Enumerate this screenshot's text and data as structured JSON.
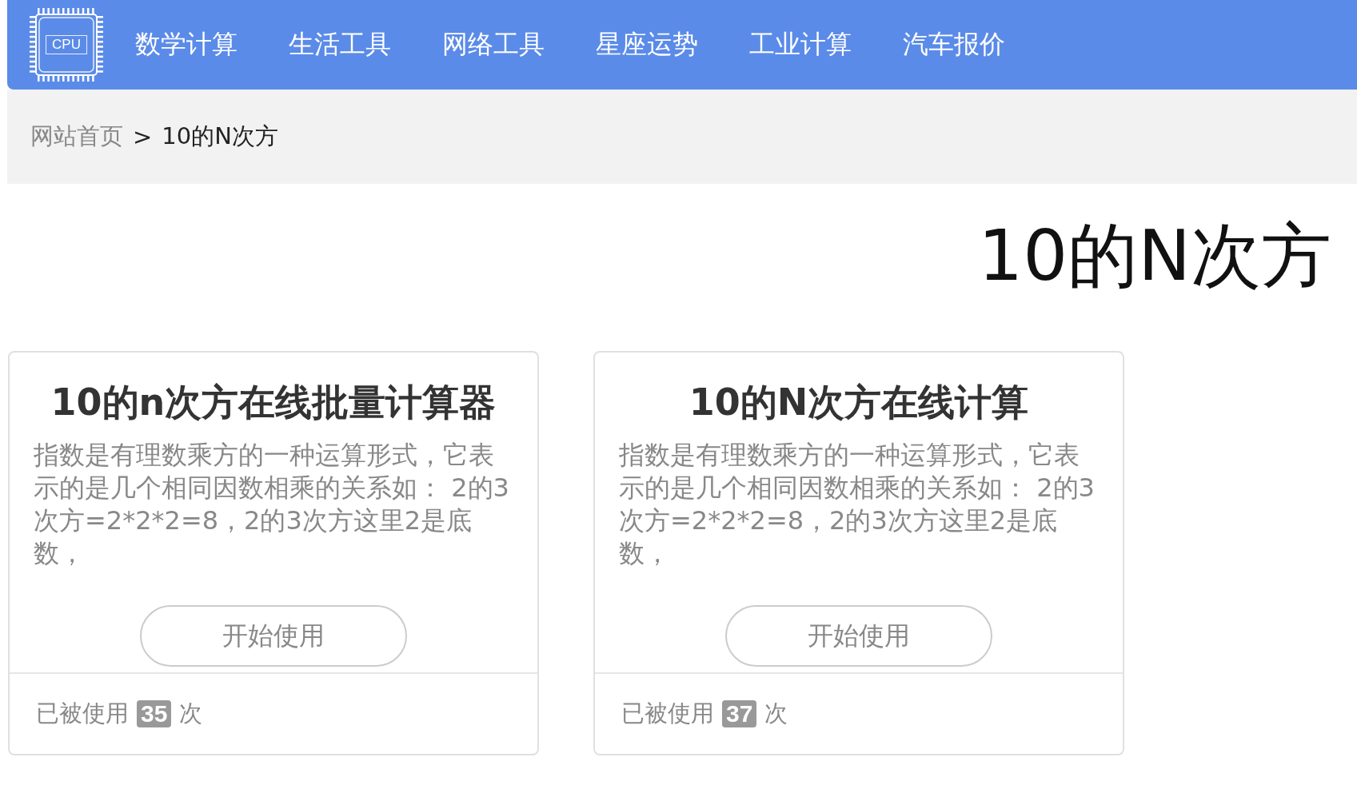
{
  "header": {
    "logo_text": "CPU",
    "nav": [
      "数学计算",
      "生活工具",
      "网络工具",
      "星座运势",
      "工业计算",
      "汽车报价"
    ]
  },
  "breadcrumb": {
    "home": "网站首页",
    "separator": ">",
    "current": "10的N次方"
  },
  "page_title": "10的N次方",
  "cards": [
    {
      "title": "10的n次方在线批量计算器",
      "description": "指数是有理数乘方的一种运算形式，它表示的是几个相同因数相乘的关系如： 2的3次方=2*2*2=8，2的3次方这里2是底数，",
      "button": "开始使用",
      "usage_prefix": "已被使用",
      "usage_count": "35",
      "usage_suffix": "次"
    },
    {
      "title": "10的N次方在线计算",
      "description": "指数是有理数乘方的一种运算形式，它表示的是几个相同因数相乘的关系如： 2的3次方=2*2*2=8，2的3次方这里2是底数，",
      "button": "开始使用",
      "usage_prefix": "已被使用",
      "usage_count": "37",
      "usage_suffix": "次"
    }
  ]
}
